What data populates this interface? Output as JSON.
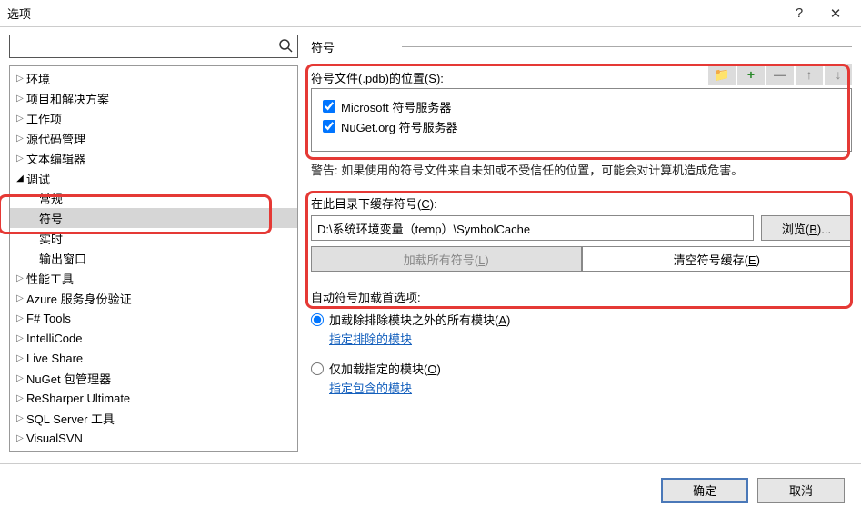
{
  "title": "选项",
  "help_icon": "?",
  "close_icon": "✕",
  "search": {
    "placeholder": ""
  },
  "tree": [
    {
      "label": "环境",
      "arrow": "▷"
    },
    {
      "label": "项目和解决方案",
      "arrow": "▷"
    },
    {
      "label": "工作项",
      "arrow": "▷"
    },
    {
      "label": "源代码管理",
      "arrow": "▷"
    },
    {
      "label": "文本编辑器",
      "arrow": "▷"
    },
    {
      "label": "调试",
      "arrow": "◢",
      "expanded": true
    },
    {
      "label": "常规",
      "child": true
    },
    {
      "label": "符号",
      "child": true,
      "selected": true
    },
    {
      "label": "实时",
      "child": true
    },
    {
      "label": "输出窗口",
      "child": true
    },
    {
      "label": "性能工具",
      "arrow": "▷"
    },
    {
      "label": "Azure 服务身份验证",
      "arrow": "▷"
    },
    {
      "label": "F# Tools",
      "arrow": "▷"
    },
    {
      "label": "IntelliCode",
      "arrow": "▷"
    },
    {
      "label": "Live Share",
      "arrow": "▷"
    },
    {
      "label": "NuGet 包管理器",
      "arrow": "▷"
    },
    {
      "label": "ReSharper Ultimate",
      "arrow": "▷"
    },
    {
      "label": "SQL Server 工具",
      "arrow": "▷"
    },
    {
      "label": "VisualSVN",
      "arrow": "▷"
    }
  ],
  "right": {
    "heading": "符号",
    "symbols_label_pre": "符号文件(.pdb)的位置(",
    "symbols_label_u": "S",
    "symbols_label_post": "):",
    "tool_folder": "📁",
    "tool_plus": "+",
    "tool_minus": "—",
    "tool_up": "↑",
    "tool_down": "↓",
    "servers": [
      {
        "name": "Microsoft 符号服务器",
        "checked": true
      },
      {
        "name": "NuGet.org 符号服务器",
        "checked": true
      }
    ],
    "warning": "警告: 如果使用的符号文件来自未知或不受信任的位置，可能会对计算机造成危害。",
    "cache_label_pre": "在此目录下缓存符号(",
    "cache_label_u": "C",
    "cache_label_post": "):",
    "cache_path": "D:\\系统环境变量（temp）\\SymbolCache",
    "browse_pre": "浏览(",
    "browse_u": "B",
    "browse_post": ")...",
    "load_all_pre": "加载所有符号(",
    "load_all_u": "L",
    "load_all_post": ")",
    "clear_pre": "清空符号缓存(",
    "clear_u": "E",
    "clear_post": ")",
    "auto_heading": "自动符号加载首选项:",
    "radio1_pre": "加载除排除模块之外的所有模块(",
    "radio1_u": "A",
    "radio1_post": ")",
    "link1": "指定排除的模块",
    "radio2_pre": "仅加载指定的模块(",
    "radio2_u": "O",
    "radio2_post": ")",
    "link2": "指定包含的模块"
  },
  "footer": {
    "ok": "确定",
    "cancel": "取消"
  }
}
